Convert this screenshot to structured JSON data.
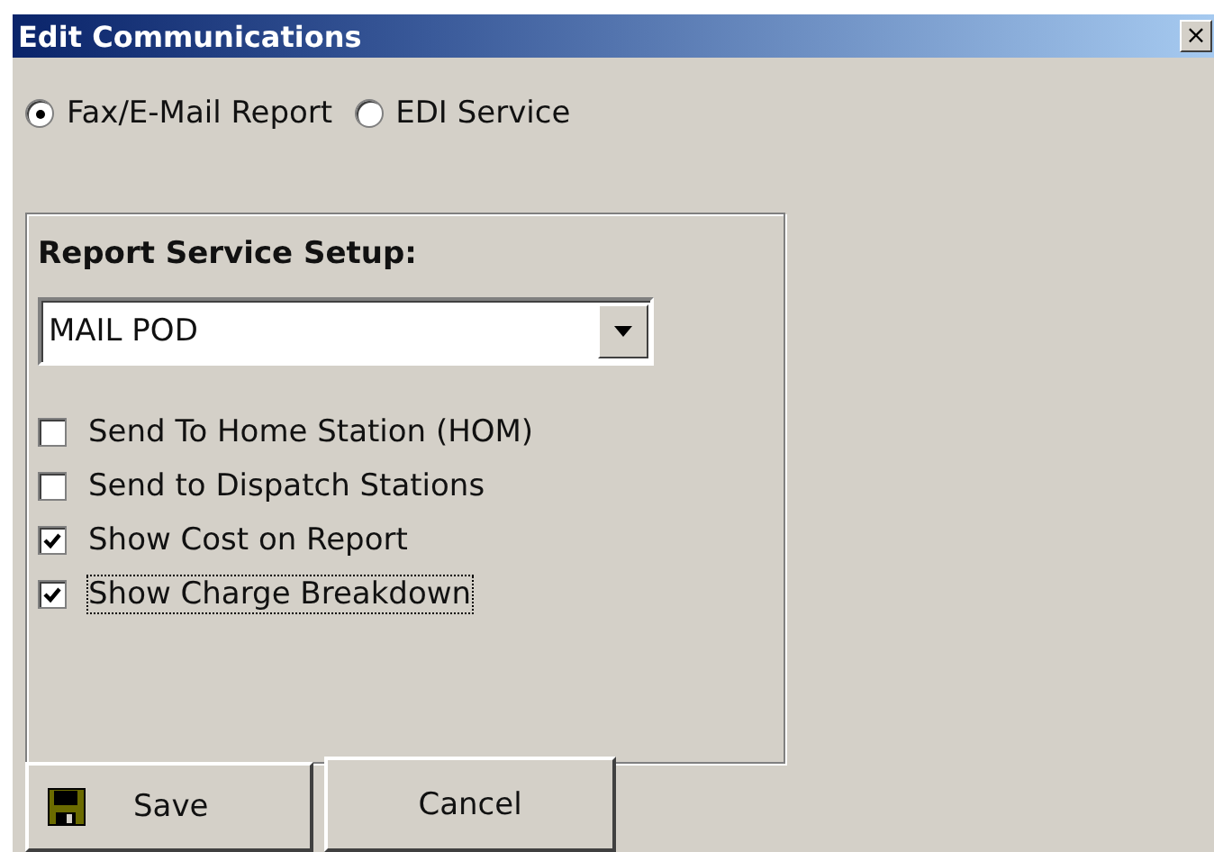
{
  "window": {
    "title": "Edit Communications",
    "close": "×"
  },
  "report_type": [
    {
      "label": "Fax/E-Mail Report",
      "selected": true
    },
    {
      "label": "EDI Service",
      "selected": false
    }
  ],
  "group": {
    "label": "Report Service Setup:",
    "dropdown": {
      "value": "MAIL POD"
    },
    "options": [
      {
        "label": "Send To Home Station (HOM)",
        "checked": false,
        "focused": false
      },
      {
        "label": "Send to Dispatch Stations",
        "checked": false,
        "focused": false
      },
      {
        "label": "Show Cost on Report",
        "checked": true,
        "focused": false
      },
      {
        "label": "Show Charge Breakdown",
        "checked": true,
        "focused": true
      }
    ]
  },
  "buttons": [
    {
      "label": "Save",
      "kind": "save"
    },
    {
      "label": "Cancel",
      "kind": "plain"
    }
  ]
}
